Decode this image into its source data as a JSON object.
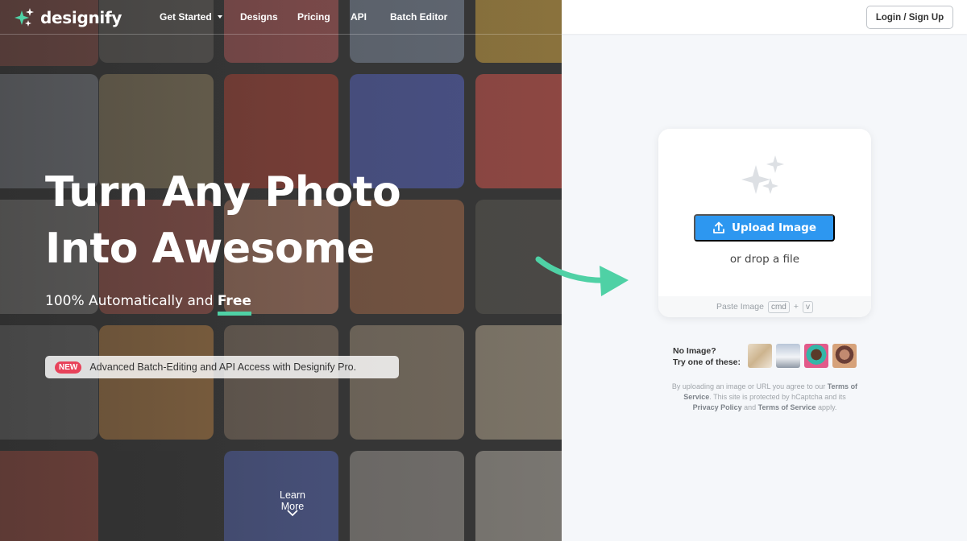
{
  "brand": {
    "name": "designify",
    "accent": "#4fd1a5"
  },
  "nav": {
    "get_started": "Get Started",
    "designs": "Designs",
    "pricing": "Pricing",
    "api": "API",
    "batch_editor": "Batch Editor",
    "login": "Login / Sign Up"
  },
  "hero": {
    "line1": "Turn Any Photo",
    "line2": "Into Awesome",
    "sub_prefix": "100% Automatically and ",
    "sub_emph": "Free",
    "badge": "NEW",
    "promo": "Advanced Batch-Editing and API Access with Designify Pro.",
    "learn_more": "Learn More"
  },
  "upload": {
    "button": "Upload Image",
    "drop": "or drop a file",
    "paste_label": "Paste Image",
    "key_cmd": "cmd",
    "plus": "+",
    "key_v": "v",
    "button_color": "#2d97f0"
  },
  "samples": {
    "line1": "No Image?",
    "line2": "Try one of these:"
  },
  "legal": {
    "t1": "By uploading an image or URL you agree to our ",
    "terms": "Terms of Service",
    "t2": ". This site is protected by hCaptcha and its ",
    "privacy": "Privacy Policy",
    "t3": " and ",
    "tos": "Terms of Service",
    "t4": " apply."
  }
}
